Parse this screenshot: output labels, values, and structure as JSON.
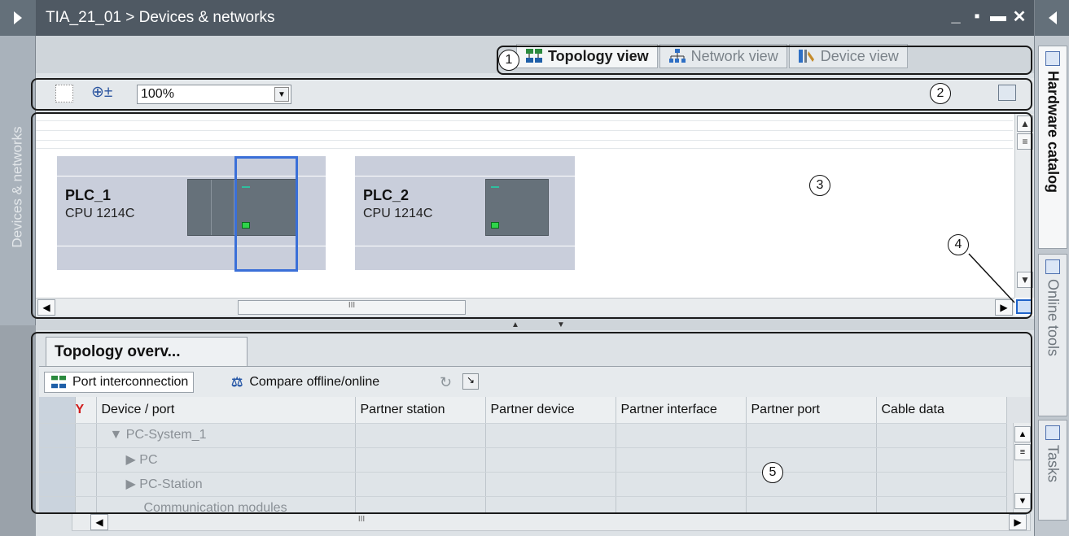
{
  "window": {
    "title": "TIA_21_01 > Devices & networks",
    "controls": [
      "_",
      "▪",
      "▬",
      "✕"
    ]
  },
  "left_panel": {
    "label": "Devices & networks"
  },
  "view_tabs": [
    {
      "label": "Topology view",
      "active": true,
      "icon": "topology-icon"
    },
    {
      "label": "Network view",
      "active": false,
      "icon": "network-icon"
    },
    {
      "label": "Device view",
      "active": false,
      "icon": "device-icon"
    }
  ],
  "toolbar": {
    "zoom_value": "100%"
  },
  "devices": [
    {
      "name": "PLC_1",
      "cpu": "CPU 1214C",
      "selected": true
    },
    {
      "name": "PLC_2",
      "cpu": "CPU 1214C",
      "selected": false
    }
  ],
  "bottom_pane": {
    "tab_label": "Topology overv...",
    "port_interconnection_label": "Port interconnection",
    "compare_label": "Compare offline/online",
    "columns": [
      "Device / port",
      "Partner station",
      "Partner device",
      "Partner interface",
      "Partner port",
      "Cable data"
    ],
    "rows": [
      {
        "label": "PC-System_1",
        "indent": 1,
        "toggle": "▼"
      },
      {
        "label": "PC",
        "indent": 2,
        "toggle": "▶"
      },
      {
        "label": "PC-Station",
        "indent": 2,
        "toggle": "▶"
      },
      {
        "label": "Communication modules",
        "indent": 3,
        "toggle": ""
      }
    ]
  },
  "right_panel": {
    "tabs": [
      {
        "label": "Hardware catalog",
        "active": true
      },
      {
        "label": "Online tools",
        "active": false
      },
      {
        "label": "Tasks",
        "active": false
      }
    ]
  },
  "callouts": [
    "1",
    "2",
    "3",
    "4",
    "5"
  ],
  "colors": {
    "titlebar": "#4f5963",
    "selection": "#3a6fd8",
    "led_green": "#2fd34a"
  }
}
